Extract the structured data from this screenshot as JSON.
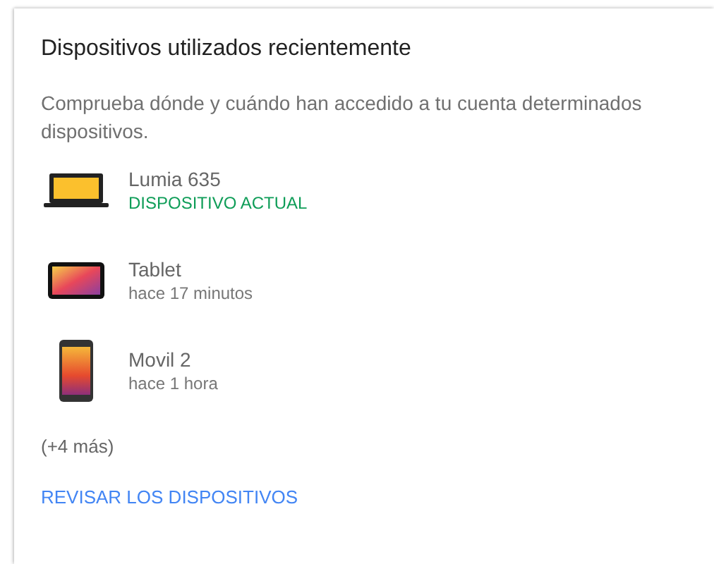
{
  "card": {
    "title": "Dispositivos utilizados recientemente",
    "description": "Comprueba dónde y cuándo han accedido a tu cuenta determinados dispositivos.",
    "devices": [
      {
        "kind": "laptop",
        "name": "Lumia 635",
        "status": "DISPOSITIVO ACTUAL",
        "current": true
      },
      {
        "kind": "tablet",
        "name": "Tablet",
        "status": "hace 17 minutos",
        "current": false
      },
      {
        "kind": "phone",
        "name": "Movil 2",
        "status": "hace 1 hora",
        "current": false
      }
    ],
    "more": "(+4 más)",
    "link": "REVISAR LOS DISPOSITIVOS"
  }
}
